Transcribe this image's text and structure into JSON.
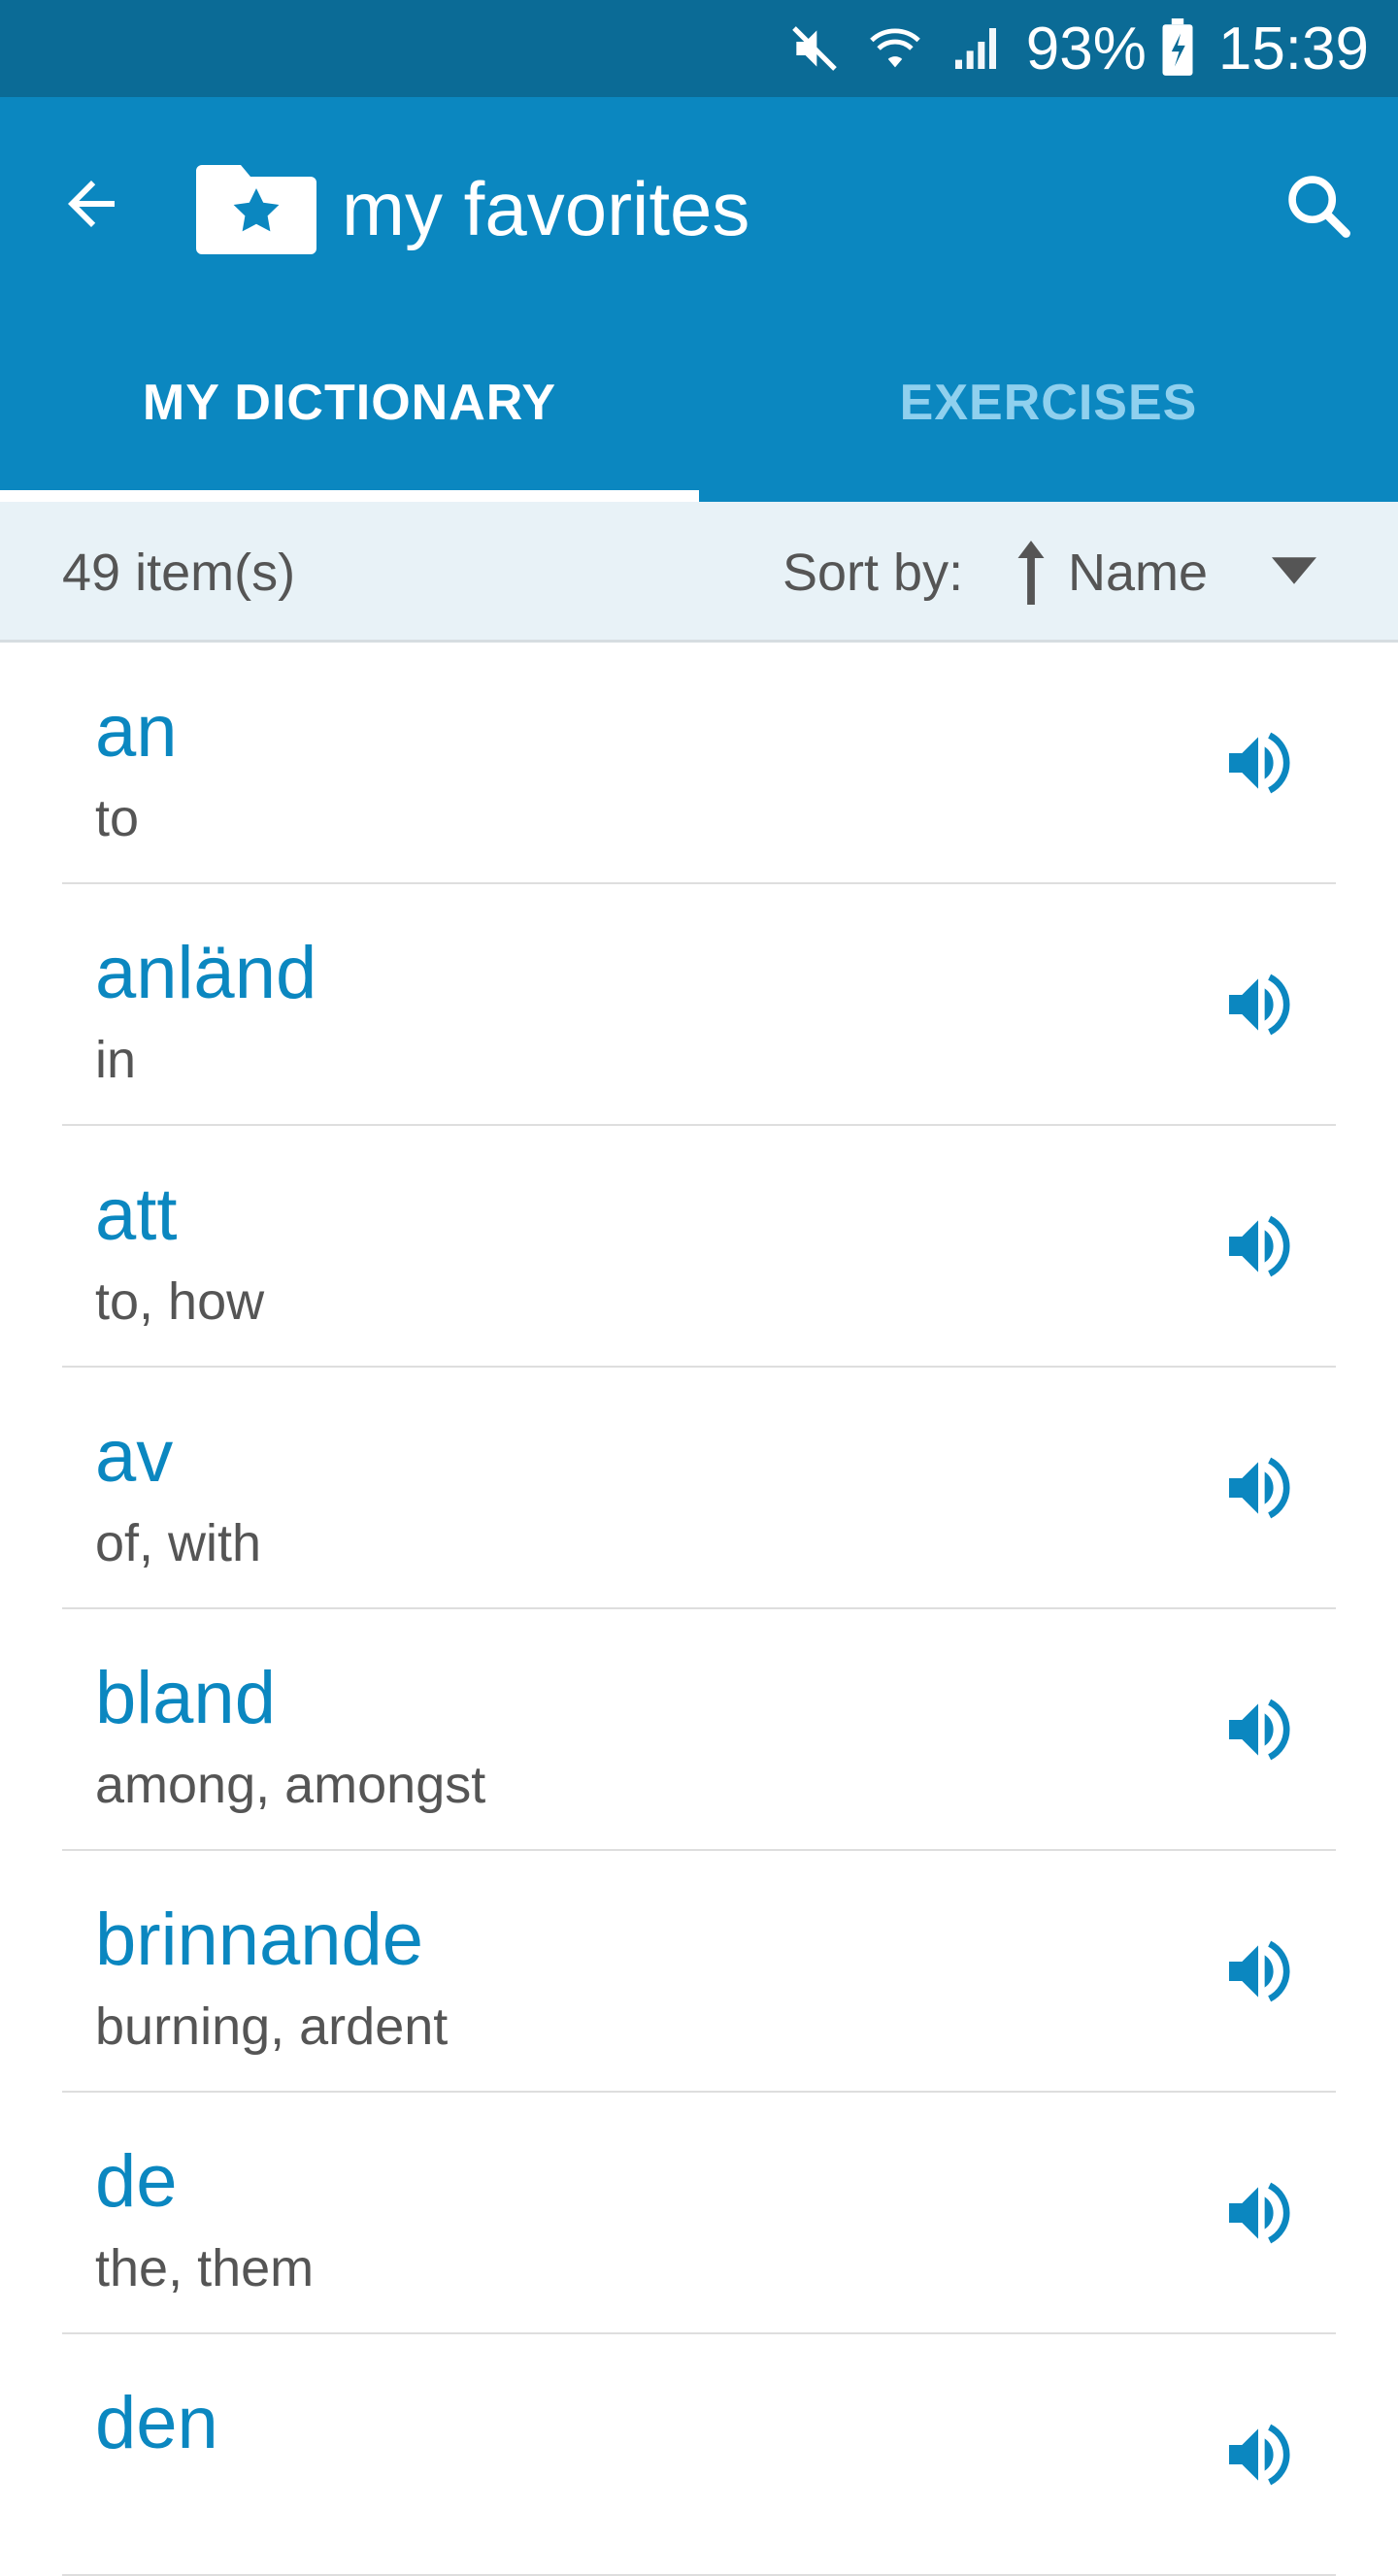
{
  "status_bar": {
    "battery": "93%",
    "time": "15:39",
    "icons": [
      "mute-icon",
      "wifi-icon",
      "signal-icon",
      "battery-charging-icon"
    ]
  },
  "app_bar": {
    "title": "my favorites",
    "icons": [
      "back-arrow-icon",
      "favorites-folder-icon",
      "search-icon"
    ]
  },
  "tabs": [
    {
      "label": "MY DICTIONARY",
      "active": true
    },
    {
      "label": "EXERCISES",
      "active": false
    }
  ],
  "sort_bar": {
    "count": "49 item(s)",
    "sort_label": "Sort by:",
    "sort_value": "Name"
  },
  "items": [
    {
      "word": "an",
      "translation": "to"
    },
    {
      "word": "anländ",
      "translation": "in"
    },
    {
      "word": "att",
      "translation": "to, how"
    },
    {
      "word": "av",
      "translation": "of, with"
    },
    {
      "word": "bland",
      "translation": "among, amongst"
    },
    {
      "word": "brinnande",
      "translation": "burning, ardent"
    },
    {
      "word": "de",
      "translation": "the, them"
    },
    {
      "word": "den",
      "translation": ""
    }
  ],
  "colors": {
    "status_bar": "#0b6b96",
    "primary": "#0b87c0",
    "tab_inactive": "#8fd0ee",
    "sort_bar_bg": "#e8f2f7"
  }
}
